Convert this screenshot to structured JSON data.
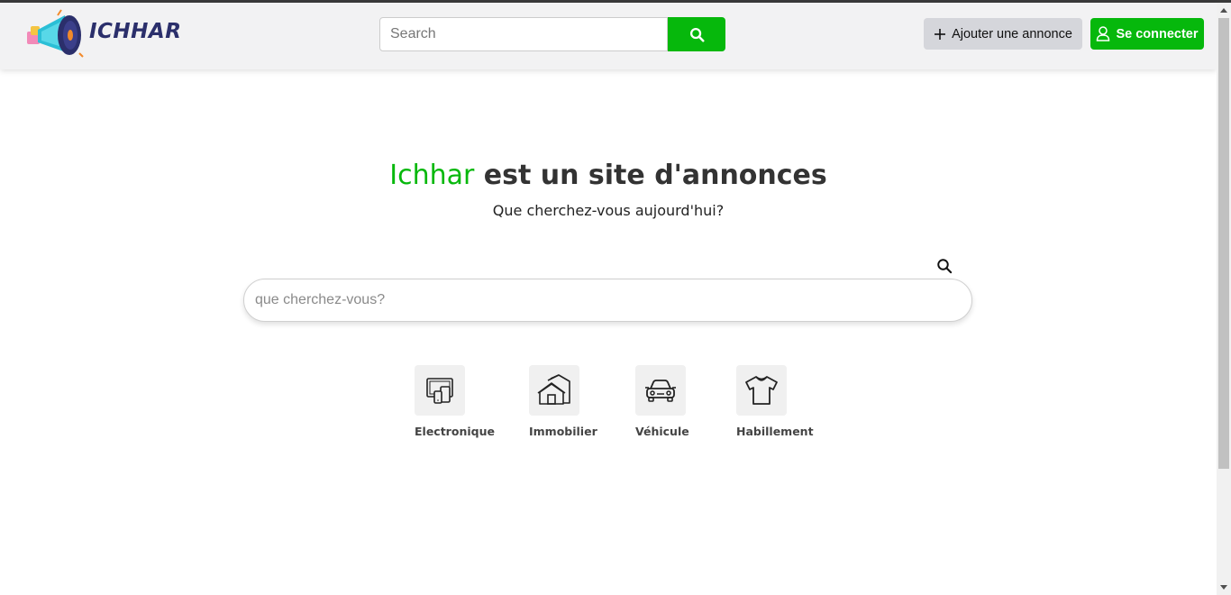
{
  "header": {
    "logo_text": "ICHHAR",
    "search": {
      "placeholder": "Search",
      "value": ""
    },
    "add_button_label": "Ajouter une annonce",
    "login_button_label": "Se connecter"
  },
  "hero": {
    "brand": "Ichhar",
    "title_rest": " est un site d'annonces",
    "subtitle": "Que cherchez-vous aujourd'hui?"
  },
  "main_search": {
    "placeholder": "que cherchez-vous?",
    "value": ""
  },
  "categories": [
    {
      "label": "Electronique",
      "icon": "devices-icon"
    },
    {
      "label": "Immobilier",
      "icon": "house-icon"
    },
    {
      "label": "Véhicule",
      "icon": "car-icon"
    },
    {
      "label": "Habillement",
      "icon": "tshirt-icon"
    }
  ],
  "colors": {
    "accent": "#06b80c",
    "brand_dark": "#2b2f6b",
    "secondary_button": "#d5d6db"
  }
}
